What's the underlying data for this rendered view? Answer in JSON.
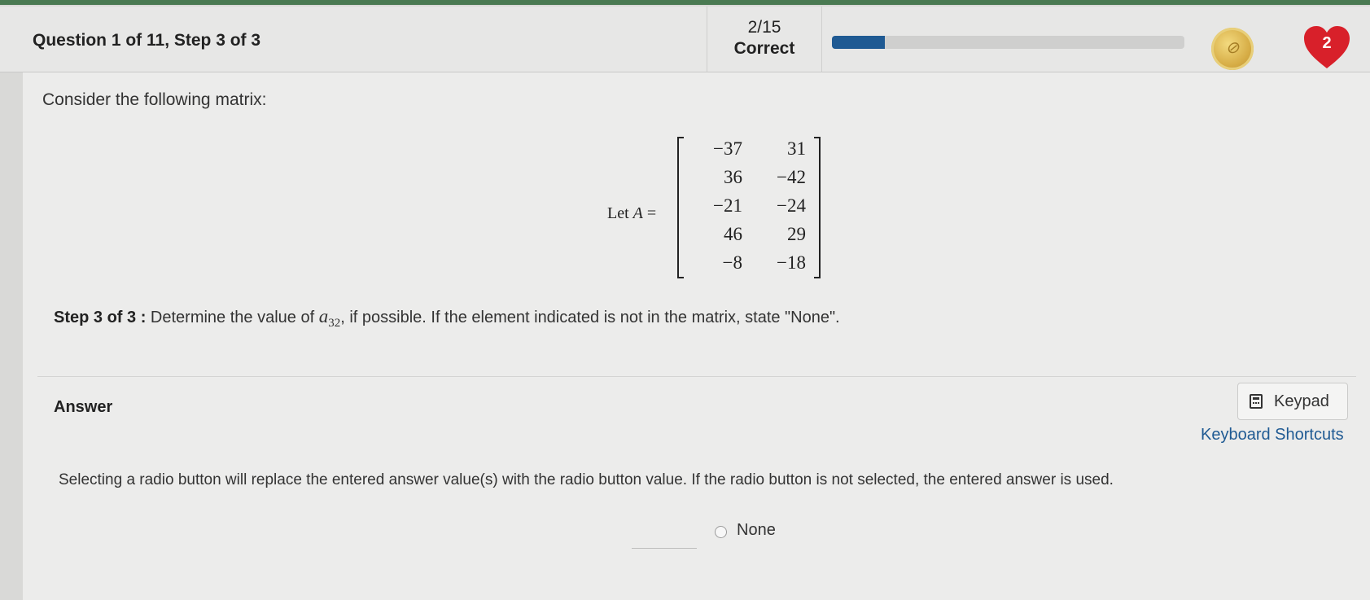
{
  "header": {
    "question_title": "Question 1 of 11, Step 3 of 3",
    "score_fraction": "2/15",
    "score_status": "Correct",
    "progress_fraction": 0.15,
    "hearts_count": "2",
    "colors": {
      "progress": "#1f5a93",
      "heart": "#d8202a",
      "coin": "#d6ac45"
    }
  },
  "problem": {
    "prompt": "Consider the following matrix:",
    "let_prefix": "Let",
    "matrix_var": "A",
    "equals": "=",
    "matrix_rows": [
      [
        "−37",
        "31"
      ],
      [
        "36",
        "−42"
      ],
      [
        "−21",
        "−24"
      ],
      [
        "46",
        "29"
      ],
      [
        "−8",
        "−18"
      ]
    ],
    "step_label": "Step 3 of 3 :",
    "step_text_before": "Determine the value of",
    "step_var": "a",
    "step_subscript": "32",
    "step_text_after": ", if possible. If the element indicated is not in the matrix, state \"None\"."
  },
  "answer": {
    "label": "Answer",
    "keypad_label": "Keypad",
    "keyboard_shortcuts": "Keyboard Shortcuts",
    "instructions": "Selecting a radio button will replace the entered answer value(s) with the radio button value. If the radio button is not selected, the entered answer is used.",
    "input_value": "",
    "radio_label": "None",
    "radio_selected": false
  },
  "icons": [
    "coin-icon",
    "heart-icon",
    "keypad-icon",
    "radio-icon"
  ]
}
